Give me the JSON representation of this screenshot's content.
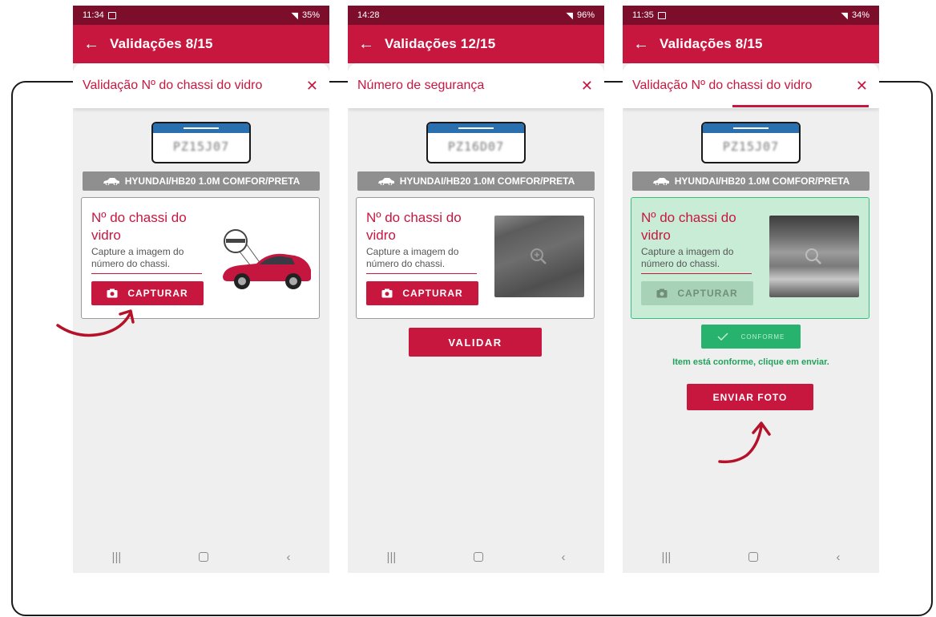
{
  "screens": [
    {
      "status_time": "11:34",
      "status_icons": "⃛⁠ ⋮ 35%",
      "status_battery": "35%",
      "app_title": "Validações 8/15",
      "sheet_title": "Validação Nº do chassi do vidro",
      "vehicle": "HYUNDAI/HB20 1.0M COMFOR/PRETA",
      "card_title": "Nº do chassi do vidro",
      "card_sub": "Capture a imagem do número do chassi.",
      "capture_label": "CAPTURAR"
    },
    {
      "status_time": "14:28",
      "status_battery": "96%",
      "app_title": "Validações 12/15",
      "sheet_title": "Número de segurança",
      "vehicle": "HYUNDAI/HB20 1.0M COMFOR/PRETA",
      "card_title": "Nº do chassi do vidro",
      "card_sub": "Capture a imagem do número do chassi.",
      "capture_label": "CAPTURAR",
      "validate_label": "VALIDAR"
    },
    {
      "status_time": "11:35",
      "status_battery": "34%",
      "app_title": "Validações 8/15",
      "sheet_title": "Validação Nº do chassi do vidro",
      "vehicle": "HYUNDAI/HB20 1.0M COMFOR/PRETA",
      "card_title": "Nº do chassi do vidro",
      "card_sub": "Capture a imagem do número do chassi.",
      "capture_label": "CAPTURAR",
      "conforme_label": "CONFORME",
      "conforme_msg": "Item está conforme, clique em enviar.",
      "send_label": "ENVIAR FOTO"
    }
  ],
  "colors": {
    "brand": "#c8173f",
    "status_bar": "#7d0e2b",
    "success": "#27b36d",
    "success_bg": "#c9ecd7"
  },
  "icons": [
    "back-arrow-icon",
    "close-icon",
    "car-icon",
    "camera-icon",
    "zoom-icon",
    "check-icon",
    "nav-recents-icon",
    "nav-home-icon",
    "nav-back-icon"
  ]
}
